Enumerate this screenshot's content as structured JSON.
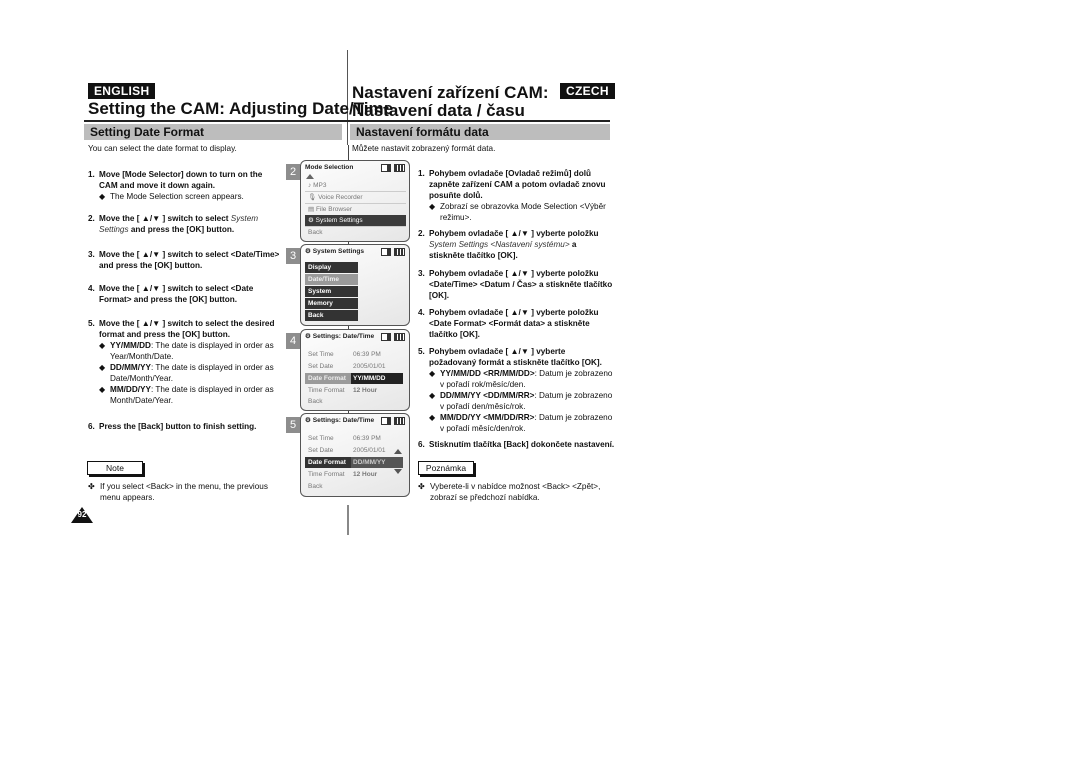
{
  "header": {
    "english_badge": "ENGLISH",
    "czech_badge": "CZECH",
    "title_en": "Setting the CAM: Adjusting Date/Time",
    "title_cz_line1": "Nastavení zařízení CAM:",
    "title_cz_line2": "Nastavení data / času"
  },
  "english": {
    "section_title": "Setting Date Format",
    "intro": "You can select the date format to display.",
    "steps": [
      {
        "num": "1.",
        "text": "Move [Mode Selector] down to turn on the CAM and move it down again.",
        "sub": [
          "The Mode Selection screen appears."
        ]
      },
      {
        "num": "2.",
        "text_before": "Move the [ ▲/▼ ] switch to select ",
        "text_italic": "System Settings",
        "text_after": " and press the [OK] button."
      },
      {
        "num": "3.",
        "text": "Move the [ ▲/▼ ] switch to select <Date/Time> and press the [OK] button."
      },
      {
        "num": "4.",
        "text": "Move the [ ▲/▼ ] switch to select <Date Format> and press the [OK] button."
      },
      {
        "num": "5.",
        "text": "Move the [ ▲/▼ ] switch to select the desired format and press the [OK] button.",
        "subs": [
          {
            "bold": "YY/MM/DD",
            "rest": ": The date is displayed in order as Year/Month/Date."
          },
          {
            "bold": "DD/MM/YY",
            "rest": ": The date is displayed in order as Date/Month/Year."
          },
          {
            "bold": "MM/DD/YY",
            "rest": ": The date is displayed in order as Month/Date/Year."
          }
        ]
      },
      {
        "num": "6.",
        "text": "Press the [Back] button to finish setting."
      }
    ],
    "note_label": "Note",
    "note_text": "If you select <Back> in the menu, the previous menu appears.",
    "page_number": "92"
  },
  "czech": {
    "section_title": "Nastavení formátu data",
    "intro": "Můžete nastavit zobrazený formát data.",
    "steps": [
      {
        "num": "1.",
        "text": "Pohybem ovladače [Ovladač režimů] dolů zapněte zařízení CAM a potom ovladač znovu posuňte dolů.",
        "sub": [
          "Zobrazí se obrazovka Mode Selection <Výběr režimu>."
        ]
      },
      {
        "num": "2.",
        "text_before": "Pohybem ovladače [ ▲/▼ ] vyberte položku ",
        "text_italic": "System Settings <Nastavení systému>",
        "text_after": " a stiskněte tlačítko [OK]."
      },
      {
        "num": "3.",
        "text": "Pohybem ovladače [ ▲/▼ ] vyberte položku <Date/Time> <Datum / Čas> a stiskněte tlačítko [OK]."
      },
      {
        "num": "4.",
        "text": "Pohybem ovladače [ ▲/▼ ] vyberte položku <Date Format> <Formát data> a stiskněte tlačítko [OK]."
      },
      {
        "num": "5.",
        "text": "Pohybem ovladače [ ▲/▼ ] vyberte požadovaný formát a stiskněte tlačítko [OK].",
        "subs": [
          {
            "bold": "YY/MM/DD <RR/MM/DD>",
            "rest": ": Datum je zobrazeno v pořadí rok/měsíc/den."
          },
          {
            "bold": "DD/MM/YY <DD/MM/RR>",
            "rest": ": Datum je zobrazeno v pořadí den/měsíc/rok."
          },
          {
            "bold": "MM/DD/YY <MM/DD/RR>",
            "rest": ": Datum je zobrazeno v pořadí měsíc/den/rok."
          }
        ]
      },
      {
        "num": "6.",
        "text": "Stisknutím tlačítka [Back] dokončete nastavení."
      }
    ],
    "note_label": "Poznámka",
    "note_text": "Vyberete-li v nabídce možnost <Back> <Zpět>, zobrazí se předchozí nabídka."
  },
  "screens": [
    {
      "num": "2",
      "title": "Mode Selection",
      "items": [
        "MP3",
        "Voice Recorder",
        "File Browser",
        "System Settings",
        "Back"
      ],
      "selected": "System Settings"
    },
    {
      "num": "3",
      "title": "System Settings",
      "items": [
        "Display",
        "Date/Time",
        "System",
        "Memory",
        "Back"
      ],
      "selected": "Date/Time"
    },
    {
      "num": "4",
      "title": "Settings: Date/Time",
      "rows": [
        {
          "label": "Set Time",
          "value": "06:39 PM"
        },
        {
          "label": "Set Date",
          "value": "2005/01/01"
        },
        {
          "label": "Date Format",
          "value": "YY/MM/DD"
        },
        {
          "label": "Time Format",
          "value": "12 Hour"
        },
        {
          "label": "Back",
          "value": ""
        }
      ]
    },
    {
      "num": "5",
      "title": "Settings: Date/Time",
      "rows": [
        {
          "label": "Set Time",
          "value": "06:39 PM"
        },
        {
          "label": "Set Date",
          "value": "2005/01/01"
        },
        {
          "label": "Date Format",
          "value": "DD/MM/YY"
        },
        {
          "label": "Time Format",
          "value": "12 Hour"
        },
        {
          "label": "Back",
          "value": ""
        }
      ]
    }
  ],
  "symbols": {
    "diamond": "◆",
    "cross": "✤"
  }
}
